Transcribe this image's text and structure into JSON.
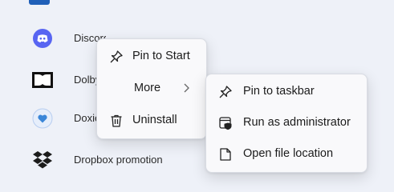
{
  "app_list": {
    "top_partial_label": "",
    "items": [
      {
        "label": "Discord",
        "icon": "discord-icon",
        "color": "#5865F2"
      },
      {
        "label": "Dolby",
        "icon": "dolby-icon",
        "color": "#111111"
      },
      {
        "label": "Doxie",
        "icon": "doxie-heart-icon",
        "color": "#3a86d8"
      },
      {
        "label": "Dropbox promotion",
        "icon": "dropbox-icon",
        "color": "#1b1b1b"
      }
    ]
  },
  "context_menu": {
    "items": [
      {
        "label": "Pin to Start",
        "icon": "pin-icon"
      },
      {
        "label": "More",
        "icon": "",
        "has_submenu": true
      },
      {
        "label": "Uninstall",
        "icon": "trash-icon"
      }
    ]
  },
  "submenu": {
    "items": [
      {
        "label": "Pin to taskbar",
        "icon": "pin-icon"
      },
      {
        "label": "Run as administrator",
        "icon": "shield-window-icon"
      },
      {
        "label": "Open file location",
        "icon": "folder-file-icon"
      }
    ]
  }
}
